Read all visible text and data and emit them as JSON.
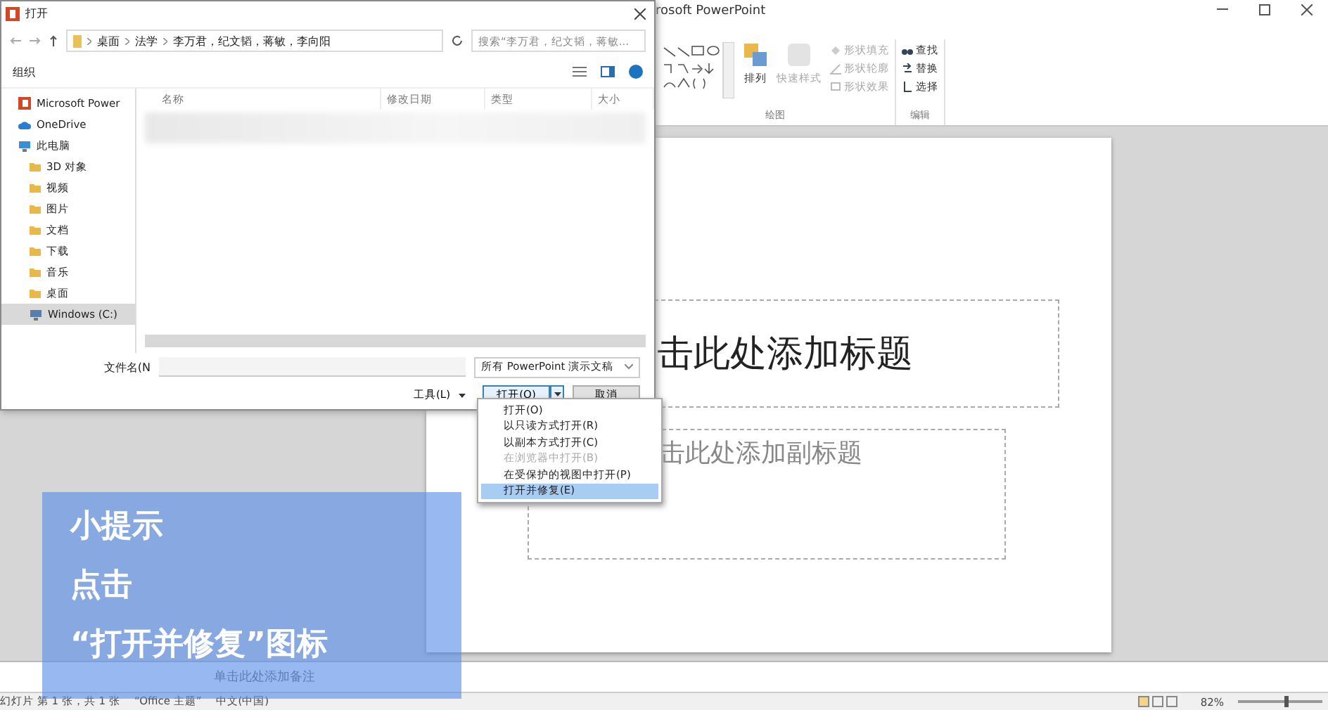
{
  "app": {
    "title": "rosoft PowerPoint"
  },
  "ribbon": {
    "groups": [
      {
        "label": "绘图",
        "arrange": "排列",
        "quick_styles": "快速样式",
        "shape_commands": [
          {
            "label": "形状填充",
            "kind": "fill"
          },
          {
            "label": "形状轮廓",
            "kind": "outline"
          },
          {
            "label": "形状效果",
            "kind": "effect"
          }
        ]
      },
      {
        "label": "编辑",
        "commands": [
          {
            "label": "查找",
            "kind": "find"
          },
          {
            "label": "替换",
            "kind": "replace"
          },
          {
            "label": "选择",
            "kind": "select"
          }
        ]
      }
    ]
  },
  "slide": {
    "title_placeholder": "击此处添加标题",
    "subtitle_placeholder": "击此处添加副标题"
  },
  "notes": {
    "placeholder": "单击此处添加备注"
  },
  "status_bar": {
    "slide_info": "幻灯片 第 1 张，共 1 张",
    "theme": "“Office 主题”",
    "language": "中文(中国)",
    "zoom": "82%",
    "zoom_slider": {
      "level": 0.55
    }
  },
  "dialog": {
    "title": "打开",
    "path": [
      "桌面",
      "法学",
      "李万君，纪文韬，蒋敏，李向阳"
    ],
    "search": {
      "placeholder": "搜索“李万君，纪文韬，蒋敏..."
    },
    "organize": "组织",
    "nav": [
      {
        "label": "Microsoft Power",
        "kind": "app",
        "selected": false
      },
      {
        "label": "OneDrive",
        "kind": "cloud",
        "selected": false
      },
      {
        "label": "此电脑",
        "kind": "pc",
        "selected": false
      },
      {
        "label": "3D 对象",
        "kind": "folder",
        "selected": false
      },
      {
        "label": "视频",
        "kind": "folder",
        "selected": false
      },
      {
        "label": "图片",
        "kind": "folder",
        "selected": false
      },
      {
        "label": "文档",
        "kind": "folder",
        "selected": false
      },
      {
        "label": "下载",
        "kind": "folder",
        "selected": false
      },
      {
        "label": "音乐",
        "kind": "folder",
        "selected": false
      },
      {
        "label": "桌面",
        "kind": "folder",
        "selected": false
      },
      {
        "label": "Windows (C:)",
        "kind": "drive",
        "selected": true
      }
    ],
    "columns": [
      "名称",
      "修改日期",
      "类型",
      "大小"
    ],
    "filename_label": "文件名(N",
    "file_type": "所有 PowerPoint 演示文稿",
    "tools": "工具(L)",
    "open": "打开(O)",
    "cancel": "取消",
    "open_menu": [
      {
        "label": "打开(O)",
        "disabled": false,
        "selected": false
      },
      {
        "label": "以只读方式打开(R)",
        "disabled": false,
        "selected": false
      },
      {
        "label": "以副本方式打开(C)",
        "disabled": false,
        "selected": false
      },
      {
        "label": "在浏览器中打开(B)",
        "disabled": true,
        "selected": false
      },
      {
        "label": "在受保护的视图中打开(P)",
        "disabled": false,
        "selected": false
      },
      {
        "label": "打开并修复(E)",
        "disabled": false,
        "selected": true
      }
    ]
  },
  "tip": {
    "lines": [
      "小提示",
      "点击",
      "“打开并修复”图标"
    ]
  }
}
